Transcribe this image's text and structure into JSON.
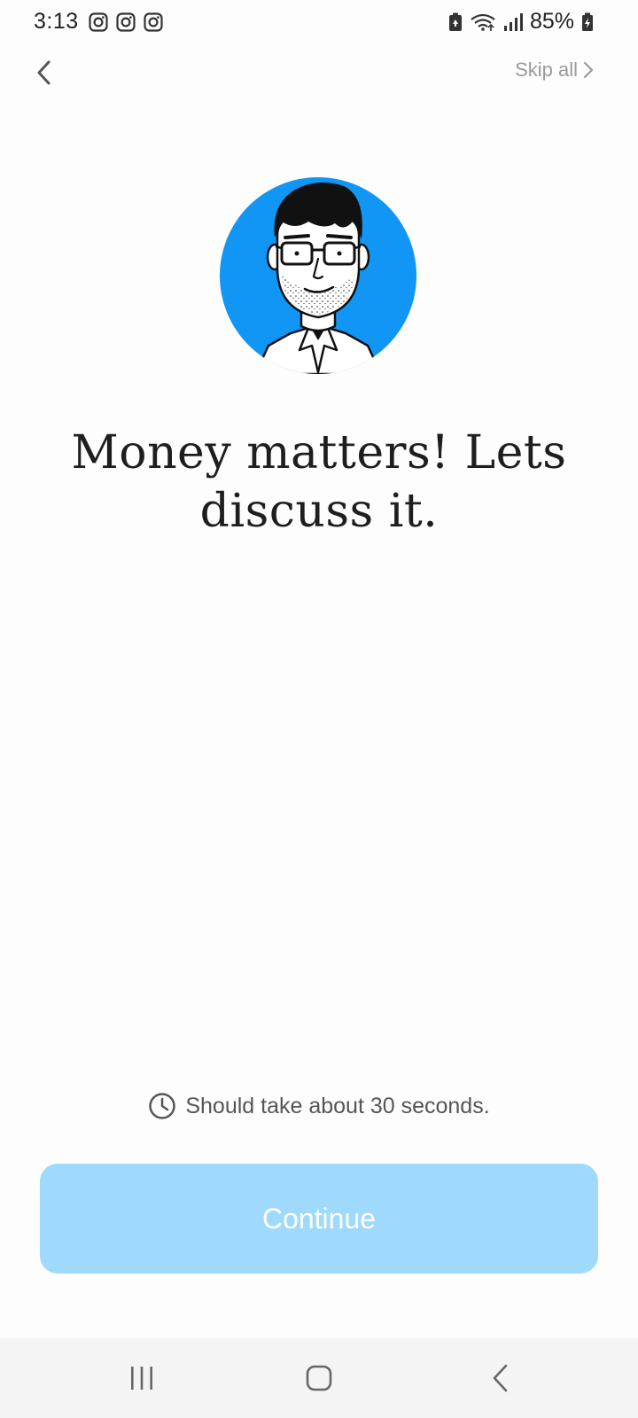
{
  "status_bar": {
    "time": "3:13",
    "notification_icons": [
      "instagram-icon",
      "instagram-icon",
      "instagram-icon"
    ],
    "battery_percent": "85%"
  },
  "top_nav": {
    "skip_label": "Skip all"
  },
  "main": {
    "headline": "Money matters! Lets discuss it.",
    "duration_hint": "Should take about 30 seconds.",
    "continue_label": "Continue"
  },
  "colors": {
    "avatar_bg": "#1196f5",
    "button_bg": "#9fd9fc",
    "skip_text": "#9a9a9a"
  }
}
